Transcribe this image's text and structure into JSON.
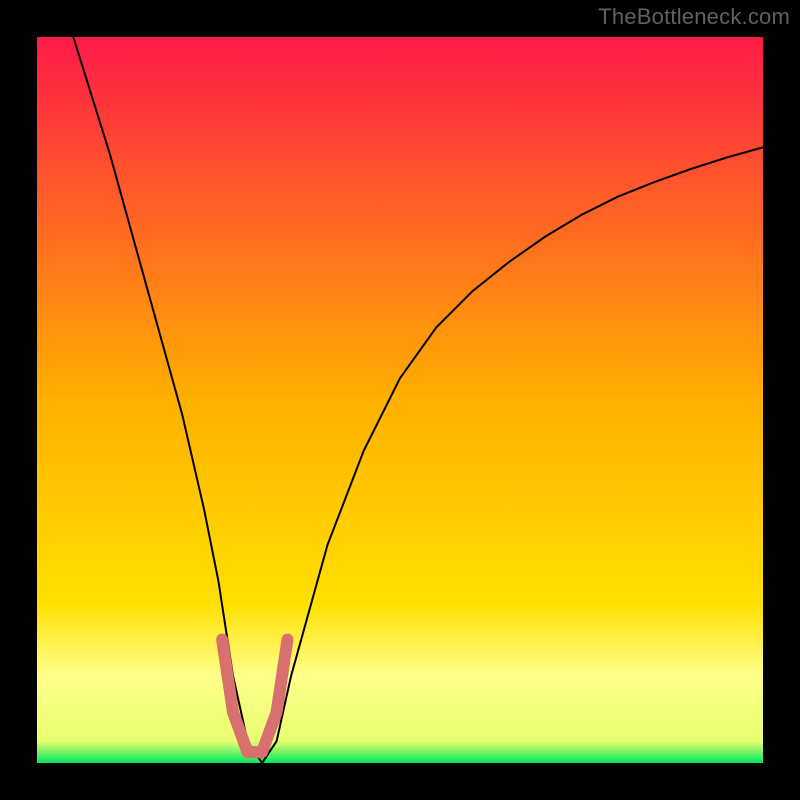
{
  "watermark": "TheBottleneck.com",
  "chart_data": {
    "type": "line",
    "title": "",
    "xlabel": "",
    "ylabel": "",
    "xlim": [
      0,
      100
    ],
    "ylim": [
      0,
      100
    ],
    "grid": false,
    "legend": false,
    "background_gradient": {
      "top_color": "#ff1a48",
      "mid_color": "#ffd400",
      "bottom_band_color": "#ffff8a",
      "bottom_edge_color": "#00e861"
    },
    "series": [
      {
        "name": "curve",
        "stroke": "#000000",
        "x": [
          5,
          10,
          15,
          20,
          23,
          25,
          27,
          29,
          31,
          33,
          35,
          40,
          45,
          50,
          55,
          60,
          65,
          70,
          75,
          80,
          85,
          90,
          95,
          100
        ],
        "y": [
          100,
          84,
          66,
          48,
          35,
          25,
          12,
          3,
          0,
          3,
          12,
          30,
          43,
          53,
          60,
          65,
          69,
          72.5,
          75.5,
          78,
          80,
          81.8,
          83.4,
          84.8
        ]
      },
      {
        "name": "valley-highlight",
        "stroke": "#d7706f",
        "stroke_width": 12,
        "x": [
          25.5,
          27,
          29,
          31,
          33,
          34.5
        ],
        "y": [
          17,
          7,
          1.5,
          1.5,
          7,
          17
        ]
      }
    ]
  }
}
